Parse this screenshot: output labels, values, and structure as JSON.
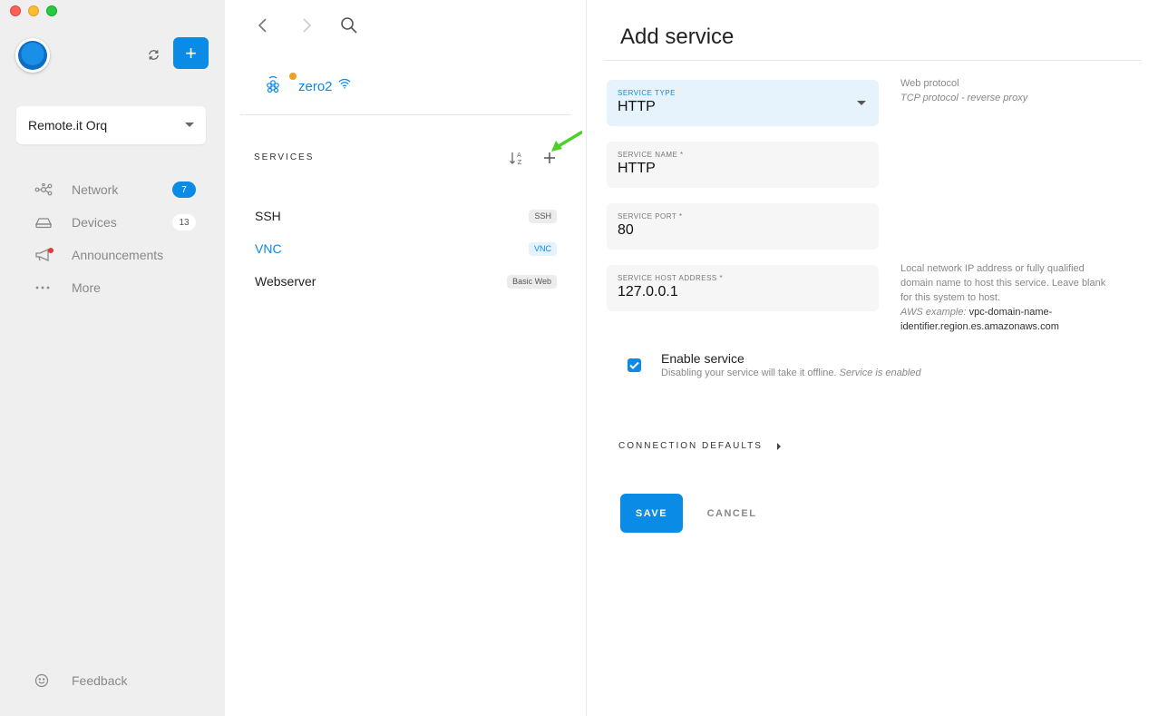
{
  "sidebar": {
    "org_name": "Remote.it Orq",
    "add_label": "+",
    "nav": [
      {
        "label": "Network",
        "badge": "7"
      },
      {
        "label": "Devices",
        "badge": "13"
      },
      {
        "label": "Announcements"
      },
      {
        "label": "More"
      }
    ],
    "feedback_label": "Feedback"
  },
  "device": {
    "name": "zero2"
  },
  "services": {
    "heading": "SERVICES",
    "items": [
      {
        "name": "SSH",
        "tag": "SSH"
      },
      {
        "name": "VNC",
        "tag": "VNC"
      },
      {
        "name": "Webserver",
        "tag": "Basic Web"
      }
    ]
  },
  "form": {
    "title": "Add service",
    "service_type": {
      "label": "SERVICE TYPE",
      "value": "HTTP"
    },
    "service_type_help": {
      "line1": "Web protocol",
      "line2": "TCP protocol - reverse proxy"
    },
    "service_name": {
      "label": "SERVICE NAME *",
      "value": "HTTP"
    },
    "service_port": {
      "label": "SERVICE PORT *",
      "value": "80"
    },
    "host_address": {
      "label": "SERVICE HOST ADDRESS *",
      "value": "127.0.0.1"
    },
    "host_help": {
      "text": "Local network IP address or fully qualified domain name to host this service. Leave blank for this system to host.",
      "example_label": "AWS example:",
      "example_value": "vpc-domain-name-identifier.region.es.amazonaws.com"
    },
    "enable": {
      "title": "Enable service",
      "subtitle": "Disabling your service will take it offline.",
      "status": "Service is enabled",
      "checked": true
    },
    "connection_defaults": "CONNECTION DEFAULTS",
    "save_label": "SAVE",
    "cancel_label": "CANCEL"
  },
  "colors": {
    "accent": "#0a8be5",
    "sidebar_bg": "#efefef",
    "arrow": "#4cd12a"
  }
}
